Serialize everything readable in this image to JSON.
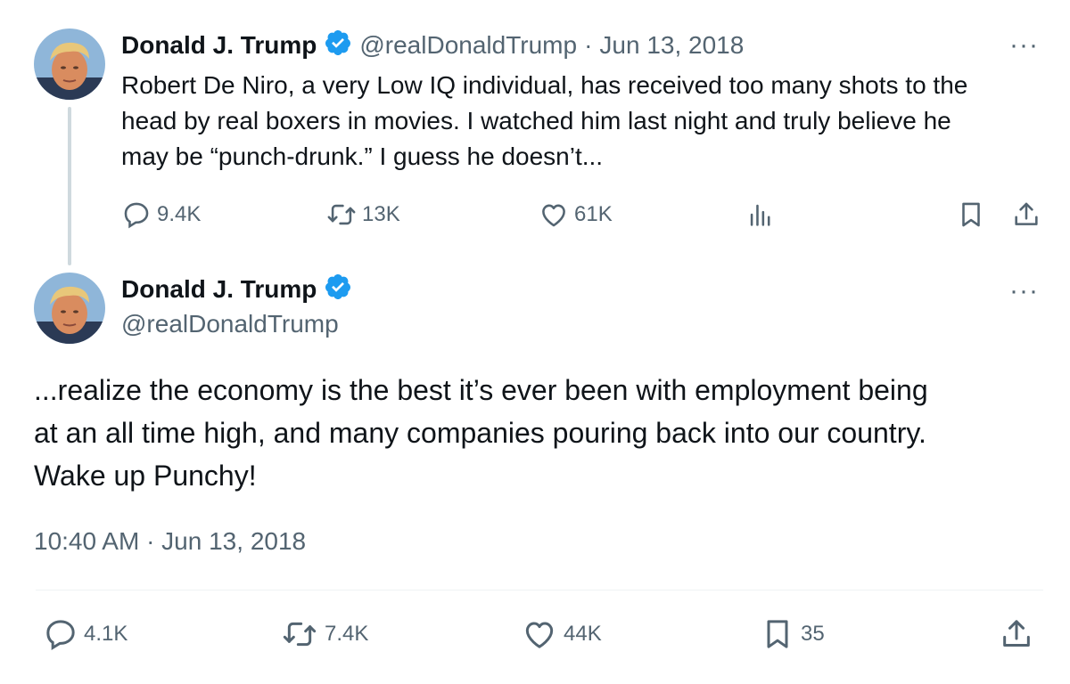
{
  "colors": {
    "text": "#0f1419",
    "secondary": "#536471",
    "verified": "#1d9bf0",
    "thread_line": "#cfd9de"
  },
  "reply_tweet": {
    "author_name": "Donald J. Trump",
    "handle": "@realDonaldTrump",
    "separator": "·",
    "date": "Jun 13, 2018",
    "more_label": "···",
    "text_lines": [
      "Robert De Niro, a very Low IQ individual, has received too many shots to the",
      "head by real boxers in movies. I watched him last night and truly believe he",
      "may be “punch-drunk.” I guess he doesn’t..."
    ],
    "stats": {
      "replies": "9.4K",
      "retweets": "13K",
      "likes": "61K"
    },
    "icons": [
      "reply-icon",
      "retweet-icon",
      "like-icon",
      "views-icon",
      "bookmark-icon",
      "share-icon"
    ]
  },
  "main_tweet": {
    "author_name": "Donald J. Trump",
    "handle": "@realDonaldTrump",
    "more_label": "···",
    "text_lines": [
      "...realize the economy is the best it’s ever been with employment being",
      "at an all time high, and many companies pouring back into our country.",
      "Wake up Punchy!"
    ],
    "timestamp": "10:40 AM · Jun 13, 2018",
    "stats": {
      "replies": "4.1K",
      "retweets": "7.4K",
      "likes": "44K",
      "bookmarks": "35"
    },
    "icons": [
      "reply-icon",
      "retweet-icon",
      "like-icon",
      "bookmark-icon",
      "share-icon"
    ]
  }
}
